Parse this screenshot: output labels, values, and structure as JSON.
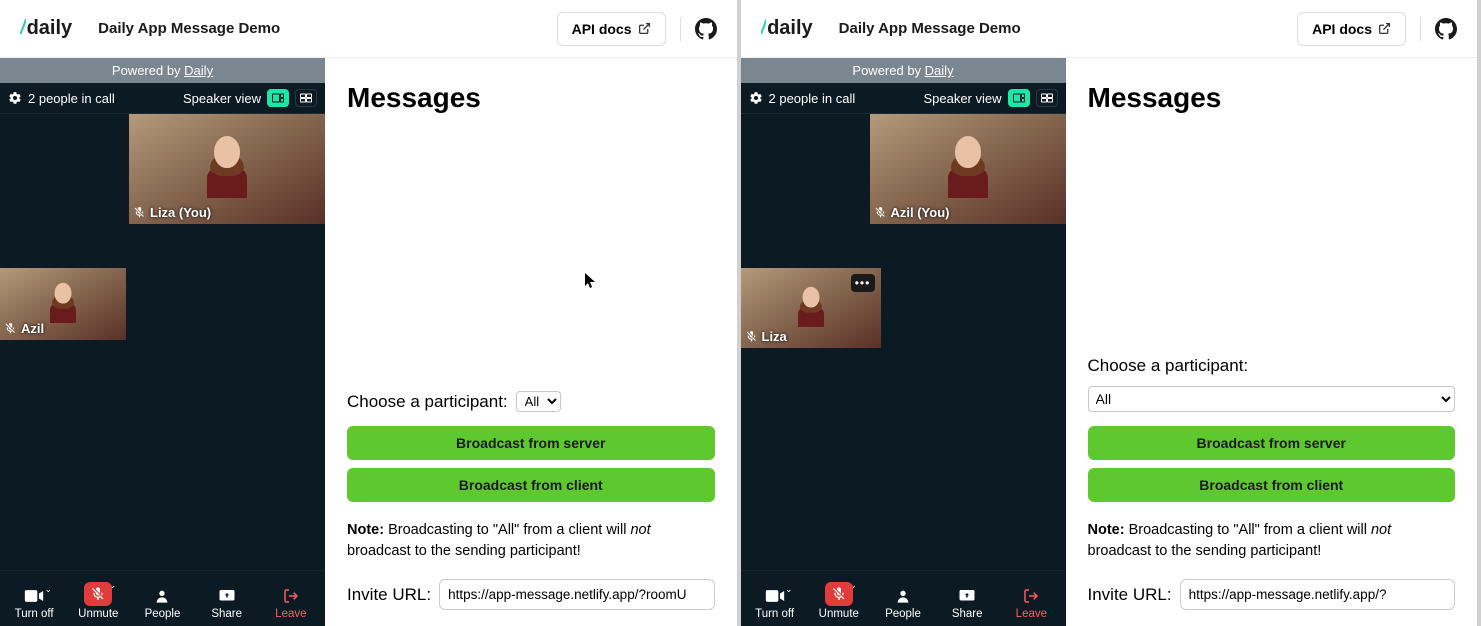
{
  "panes": [
    {
      "header": {
        "logo_text": "daily",
        "app_title": "Daily App Message Demo",
        "api_docs": "API docs"
      },
      "video": {
        "powered_prefix": "Powered by ",
        "powered_link": "Daily",
        "people_count": "2 people in call",
        "view_label": "Speaker view",
        "tiles": {
          "main": {
            "name_label": "Liza (You)"
          },
          "small": {
            "name_label": "Azil",
            "show_more": false
          }
        },
        "controls": {
          "cam": "Turn off",
          "mic": "Unmute",
          "people": "People",
          "share": "Share",
          "leave": "Leave"
        }
      },
      "messages": {
        "title": "Messages",
        "choose_label": "Choose a participant:",
        "select_value": "All",
        "select_style": "inline",
        "btn_server": "Broadcast from server",
        "btn_client": "Broadcast from client",
        "note_prefix": "Note:",
        "note_mid": "Broadcasting to \"All\" from a client will",
        "note_italic": "not",
        "note_suffix": "broadcast to the sending participant!",
        "invite_label": "Invite URL:",
        "invite_value": "https://app-message.netlify.app/?roomU",
        "show_cursor": true
      }
    },
    {
      "header": {
        "logo_text": "daily",
        "app_title": "Daily App Message Demo",
        "api_docs": "API docs"
      },
      "video": {
        "powered_prefix": "Powered by ",
        "powered_link": "Daily",
        "people_count": "2 people in call",
        "view_label": "Speaker view",
        "tiles": {
          "main": {
            "name_label": "Azil (You)"
          },
          "small": {
            "name_label": "Liza",
            "show_more": true
          }
        },
        "controls": {
          "cam": "Turn off",
          "mic": "Unmute",
          "people": "People",
          "share": "Share",
          "leave": "Leave"
        }
      },
      "messages": {
        "title": "Messages",
        "choose_label": "Choose a participant:",
        "select_value": "All",
        "select_style": "full",
        "btn_server": "Broadcast from server",
        "btn_client": "Broadcast from client",
        "note_prefix": "Note:",
        "note_mid": "Broadcasting to \"All\" from a client will",
        "note_italic": "not",
        "note_suffix": "broadcast to the sending participant!",
        "invite_label": "Invite URL:",
        "invite_value": "https://app-message.netlify.app/?",
        "show_cursor": false
      }
    }
  ]
}
